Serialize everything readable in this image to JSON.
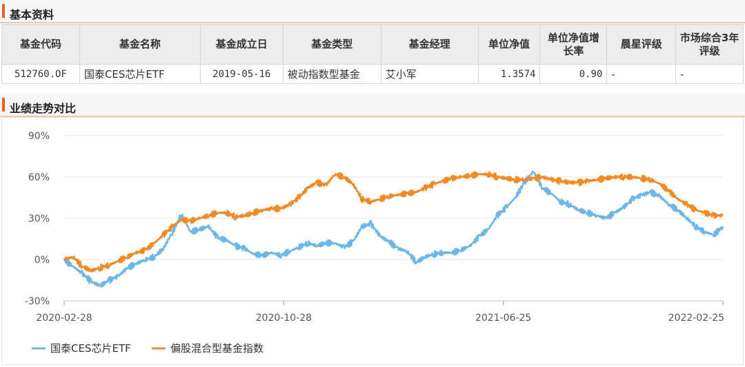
{
  "basic_section": {
    "title": "基本资料"
  },
  "table": {
    "headers": [
      "基金代码",
      "基金名称",
      "基金成立日",
      "基金类型",
      "基金经理",
      "单位净值",
      "单位净值增长率",
      "晨星评级",
      "市场综合3年评级"
    ],
    "row": [
      "512760.OF",
      "国泰CES芯片ETF",
      "2019-05-16",
      "被动指数型基金",
      "艾小军",
      "1.3574",
      "0.90",
      "-",
      "-"
    ]
  },
  "chart_section": {
    "title": "业绩走势对比"
  },
  "colors": {
    "accent": "#e8601c",
    "series_fund": "#6cb6e8",
    "series_index": "#f08a24"
  },
  "chart_data": {
    "type": "line",
    "x_tick_labels": [
      "2020-02-28",
      "2020-10-28",
      "2021-06-25",
      "2022-02-25"
    ],
    "y_tick_labels": [
      "90%",
      "60%",
      "30%",
      "0%",
      "-30%"
    ],
    "ylim": [
      -30,
      90
    ],
    "yticks": [
      90,
      60,
      30,
      0,
      -30
    ],
    "grid": true,
    "legend_position": "bottom-left",
    "series": [
      {
        "name": "国泰CES芯片ETF",
        "values": [
          0,
          -5,
          -10,
          -16,
          -19,
          -15,
          -12,
          -6,
          -3,
          0,
          2,
          8,
          20,
          33,
          20,
          22,
          24,
          16,
          14,
          10,
          8,
          4,
          3,
          5,
          3,
          6,
          9,
          12,
          10,
          12,
          12,
          9,
          13,
          24,
          26,
          17,
          13,
          8,
          6,
          -2,
          2,
          4,
          5,
          5,
          7,
          10,
          17,
          22,
          32,
          38,
          45,
          56,
          64,
          52,
          48,
          42,
          40,
          36,
          34,
          32,
          30,
          34,
          38,
          44,
          47,
          49,
          46,
          40,
          36,
          30,
          24,
          20,
          18,
          24
        ]
      },
      {
        "name": "偏股混合型基金指数",
        "values": [
          0,
          2,
          -5,
          -8,
          -6,
          -4,
          -1,
          2,
          5,
          7,
          12,
          18,
          24,
          29,
          28,
          30,
          32,
          34,
          34,
          31,
          32,
          34,
          36,
          37,
          37,
          40,
          45,
          52,
          56,
          54,
          62,
          60,
          55,
          44,
          42,
          44,
          46,
          47,
          48,
          49,
          52,
          55,
          57,
          59,
          60,
          61,
          62,
          62,
          60,
          59,
          58,
          58,
          59,
          60,
          58,
          57,
          56,
          56,
          57,
          58,
          59,
          60,
          60,
          60,
          59,
          58,
          55,
          50,
          44,
          40,
          36,
          34,
          32,
          32
        ]
      }
    ]
  }
}
